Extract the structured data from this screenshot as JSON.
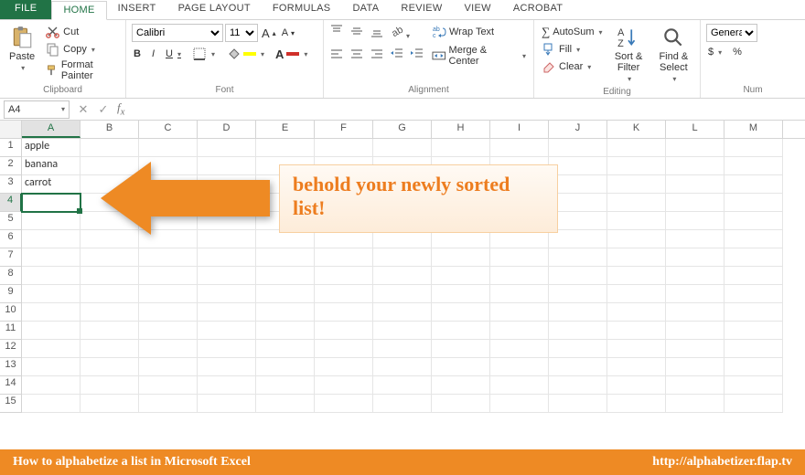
{
  "tabs": [
    "FILE",
    "HOME",
    "INSERT",
    "PAGE LAYOUT",
    "FORMULAS",
    "DATA",
    "REVIEW",
    "VIEW",
    "ACROBAT"
  ],
  "active_tab": "HOME",
  "clipboard": {
    "paste": "Paste",
    "cut": "Cut",
    "copy": "Copy",
    "painter": "Format Painter",
    "label": "Clipboard"
  },
  "font": {
    "name": "Calibri",
    "size": "11",
    "bold": "B",
    "italic": "I",
    "underline": "U",
    "label": "Font"
  },
  "alignment": {
    "wrap": "Wrap Text",
    "merge": "Merge & Center",
    "label": "Alignment"
  },
  "editing": {
    "sum": "AutoSum",
    "fill": "Fill",
    "clear": "Clear",
    "sort": "Sort & Filter",
    "find": "Find & Select",
    "label": "Editing"
  },
  "number": {
    "format": "General",
    "currency": "$",
    "percent": "%",
    "label": "Num"
  },
  "namebox": "A4",
  "columns": [
    "A",
    "B",
    "C",
    "D",
    "E",
    "F",
    "G",
    "H",
    "I",
    "J",
    "K",
    "L",
    "M"
  ],
  "rows": 15,
  "sel_col": "A",
  "sel_row": 4,
  "cells": {
    "A1": "apple",
    "A2": "banana",
    "A3": "carrot"
  },
  "callout_text": "behold your newly sorted list!",
  "footer_left": "How to alphabetize a list in Microsoft Excel",
  "footer_right": "http://alphabetizer.flap.tv"
}
